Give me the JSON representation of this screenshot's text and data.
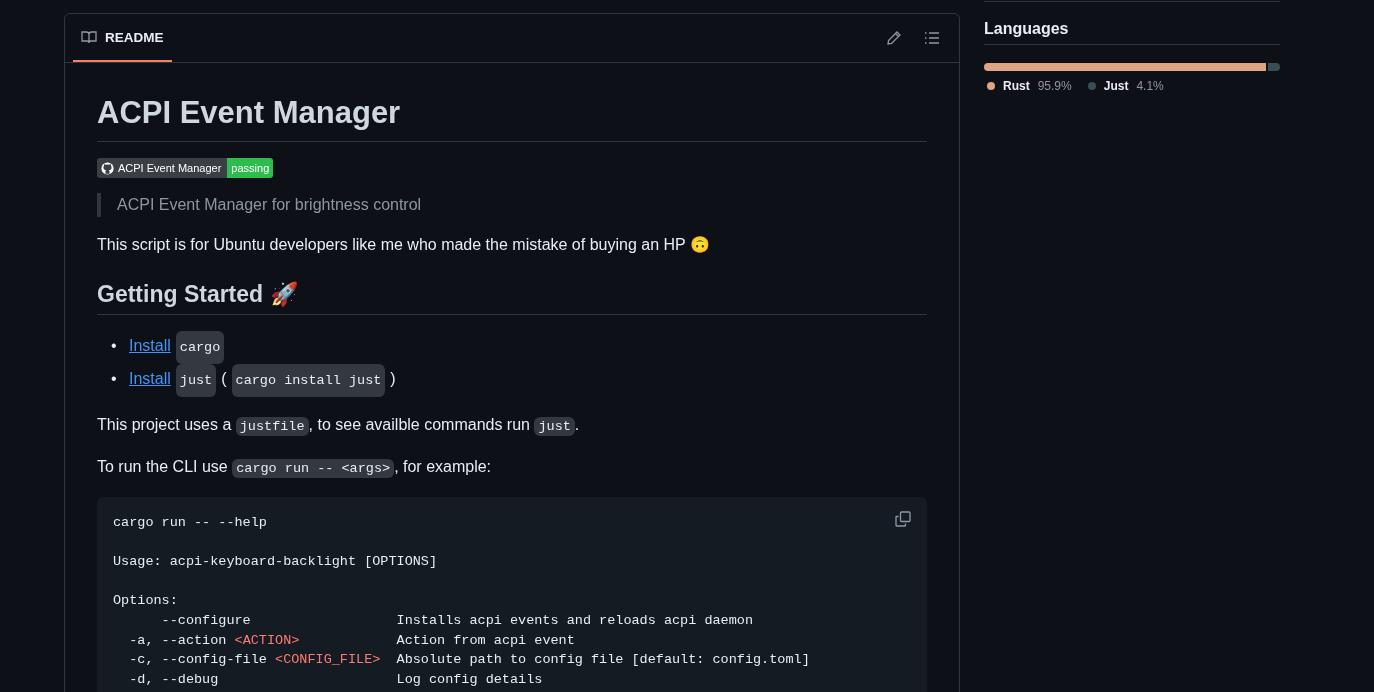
{
  "readme": {
    "tab": {
      "label": "README",
      "selected": true
    },
    "title": "ACPI Event Manager",
    "badge": {
      "label": "ACPI Event Manager",
      "status": "passing"
    },
    "quote": "ACPI Event Manager for brightness control",
    "intro": "This script is for Ubuntu developers like me who made the mistake of buying an HP 🙃",
    "section_title": "Getting Started 🚀",
    "list": [
      {
        "marker": "•",
        "segments": [
          {
            "kind": "link",
            "text": "Install"
          },
          {
            "kind": "code",
            "text": "cargo"
          }
        ]
      },
      {
        "marker": "•",
        "segments": [
          {
            "kind": "link",
            "text": "Install"
          },
          {
            "kind": "code",
            "text": "just"
          },
          {
            "kind": "text",
            "text": "("
          },
          {
            "kind": "code",
            "text": "cargo install just"
          },
          {
            "kind": "text",
            "text": ")"
          }
        ]
      }
    ],
    "paragraphs": [
      [
        {
          "kind": "text",
          "text": "This project uses a "
        },
        {
          "kind": "code",
          "text": "justfile"
        },
        {
          "kind": "text",
          "text": ", to see availble commands run "
        },
        {
          "kind": "code",
          "text": "just"
        },
        {
          "kind": "text",
          "text": "."
        }
      ],
      [
        {
          "kind": "text",
          "text": "To run the CLI use "
        },
        {
          "kind": "code",
          "text": "cargo run -- <args>"
        },
        {
          "kind": "text",
          "text": ", for example:"
        }
      ]
    ],
    "code_block": [
      {
        "kind": "line",
        "segments": [
          {
            "kind": "plain",
            "text": "cargo run -- --help"
          }
        ]
      },
      {
        "kind": "blank"
      },
      {
        "kind": "line",
        "segments": [
          {
            "kind": "plain",
            "text": "Usage: acpi-keyboard-backlight [OPTIONS]"
          }
        ]
      },
      {
        "kind": "blank"
      },
      {
        "kind": "line",
        "segments": [
          {
            "kind": "plain",
            "text": "Options:"
          }
        ]
      },
      {
        "kind": "line",
        "segments": [
          {
            "kind": "plain",
            "text": "      --configure                  Installs acpi events and reloads acpi daemon"
          }
        ]
      },
      {
        "kind": "line",
        "segments": [
          {
            "kind": "plain",
            "text": "  -a, --action "
          },
          {
            "kind": "tag",
            "text": "<ACTION>"
          },
          {
            "kind": "plain",
            "text": "            Action from acpi event"
          }
        ]
      },
      {
        "kind": "line",
        "segments": [
          {
            "kind": "plain",
            "text": "  -c, --config-file "
          },
          {
            "kind": "tag",
            "text": "<CONFIG_FILE>"
          },
          {
            "kind": "plain",
            "text": "  Absolute path to config file [default: config.toml]"
          }
        ]
      },
      {
        "kind": "line",
        "segments": [
          {
            "kind": "plain",
            "text": "  -d, --debug                      Log config details"
          }
        ]
      }
    ]
  },
  "languages": {
    "title": "Languages",
    "items": [
      {
        "name": "Rust",
        "percent": "95.9%",
        "level": 0.959,
        "color": "#dea584"
      },
      {
        "name": "Just",
        "percent": "4.1%",
        "level": 0.041,
        "color": "#384d54"
      }
    ]
  }
}
